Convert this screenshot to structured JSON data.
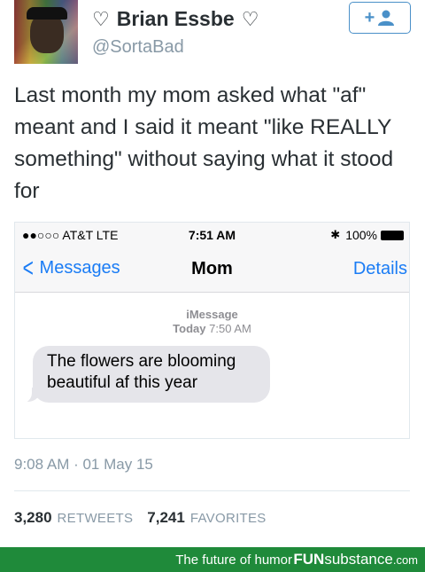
{
  "tweet": {
    "display_name": "Brian Essbe",
    "heart_left": "♡",
    "heart_right": "♡",
    "handle": "@SortaBad",
    "follow_label": "+",
    "text": "Last month my mom asked what \"af\" meant and I said it meant \"like REALLY something\" without saying what it stood for",
    "timestamp": "9:08 AM · 01 May 15",
    "retweets_count": "3,280",
    "retweets_label": "RETWEETS",
    "favorites_count": "7,241",
    "favorites_label": "FAVORITES"
  },
  "phone": {
    "status": {
      "carrier": "●●○○○ AT&T  LTE",
      "time": "7:51 AM",
      "bluetooth": "✱",
      "battery": "100%"
    },
    "nav": {
      "back_label": "Messages",
      "title": "Mom",
      "details_label": "Details"
    },
    "meta": {
      "service": "iMessage",
      "day": "Today",
      "time": "7:50 AM"
    },
    "message": "The flowers are blooming beautiful af this year"
  },
  "footer": {
    "tagline": "The future of humor",
    "brand_bold": "FUN",
    "brand_rest": "substance",
    "brand_domain": ".com"
  },
  "colors": {
    "ios_blue": "#1a7cf5",
    "bubble_gray": "#e5e5ea",
    "twitter_gray": "#8899a6",
    "footer_green": "#1f8a3a"
  }
}
